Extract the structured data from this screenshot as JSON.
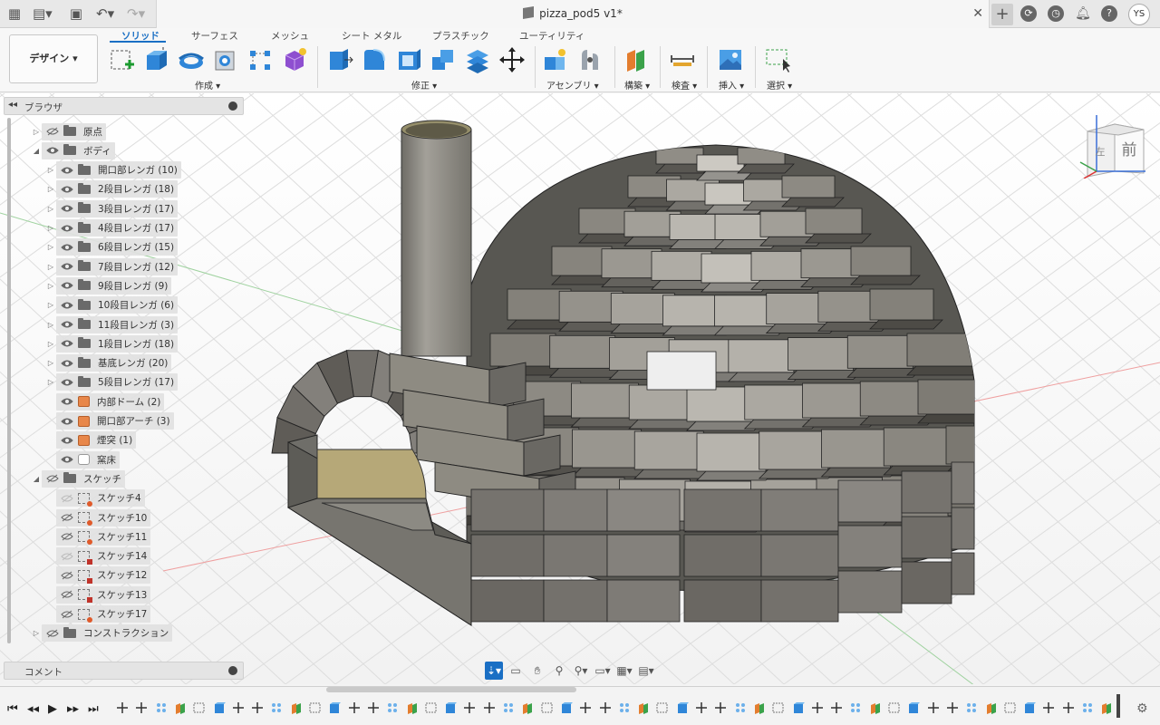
{
  "titlebar": {
    "doc_title": "pizza_pod5 v1*",
    "user_initials": "YS",
    "icons": [
      "grid-icon",
      "file-icon",
      "save-icon",
      "undo-icon",
      "redo-icon",
      "close-icon",
      "plus-icon",
      "cloud-icon",
      "clock-icon",
      "bell-icon",
      "help-icon"
    ]
  },
  "ribbon": {
    "design_label": "デザイン ▾",
    "tabs": [
      "ソリッド",
      "サーフェス",
      "メッシュ",
      "シート メタル",
      "プラスチック",
      "ユーティリティ"
    ],
    "groups": [
      "作成 ▾",
      "修正 ▾",
      "アセンブリ ▾",
      "構築 ▾",
      "検査 ▾",
      "挿入 ▾",
      "選択 ▾"
    ]
  },
  "browser": {
    "title": "ブラウザ",
    "nodes": [
      {
        "label": "原点",
        "type": "folder",
        "expand": "▷",
        "eye": "hidden",
        "level": 1
      },
      {
        "label": "ボディ",
        "type": "folder",
        "expand": "◢",
        "eye": "visible",
        "level": 1
      },
      {
        "label": "開口部レンガ (10)",
        "type": "folder",
        "expand": "▷",
        "eye": "visible",
        "level": 2
      },
      {
        "label": "2段目レンガ (18)",
        "type": "folder",
        "expand": "▷",
        "eye": "visible",
        "level": 2
      },
      {
        "label": "3段目レンガ (17)",
        "type": "folder",
        "expand": "▷",
        "eye": "visible",
        "level": 2
      },
      {
        "label": "4段目レンガ (17)",
        "type": "folder",
        "expand": "▷",
        "eye": "visible",
        "level": 2
      },
      {
        "label": "6段目レンガ (15)",
        "type": "folder",
        "expand": "▷",
        "eye": "visible",
        "level": 2
      },
      {
        "label": "7段目レンガ (12)",
        "type": "folder",
        "expand": "▷",
        "eye": "visible",
        "level": 2
      },
      {
        "label": "9段目レンガ (9)",
        "type": "folder",
        "expand": "▷",
        "eye": "visible",
        "level": 2
      },
      {
        "label": "10段目レンガ (6)",
        "type": "folder",
        "expand": "▷",
        "eye": "visible",
        "level": 2
      },
      {
        "label": "11段目レンガ (3)",
        "type": "folder",
        "expand": "▷",
        "eye": "visible",
        "level": 2
      },
      {
        "label": "1段目レンガ (18)",
        "type": "folder",
        "expand": "▷",
        "eye": "visible",
        "level": 2
      },
      {
        "label": "基底レンガ (20)",
        "type": "folder",
        "expand": "▷",
        "eye": "visible",
        "level": 2
      },
      {
        "label": "5段目レンガ (17)",
        "type": "folder",
        "expand": "▷",
        "eye": "visible",
        "level": 2
      },
      {
        "label": "内部ドーム (2)",
        "type": "body",
        "expand": "",
        "eye": "visible",
        "level": 2
      },
      {
        "label": "開口部アーチ (3)",
        "type": "body",
        "expand": "",
        "eye": "visible",
        "level": 2
      },
      {
        "label": "煙突 (1)",
        "type": "body",
        "expand": "",
        "eye": "visible",
        "level": 2
      },
      {
        "label": "窯床",
        "type": "floor",
        "expand": "",
        "eye": "visible",
        "level": 2
      },
      {
        "label": "スケッチ",
        "type": "folder",
        "expand": "◢",
        "eye": "hidden",
        "level": 1
      },
      {
        "label": "スケッチ4",
        "type": "sketch",
        "expand": "",
        "eye": "faint",
        "level": 2
      },
      {
        "label": "スケッチ10",
        "type": "sketch",
        "expand": "",
        "eye": "hidden",
        "level": 2
      },
      {
        "label": "スケッチ11",
        "type": "sketch",
        "expand": "",
        "eye": "hidden",
        "level": 2
      },
      {
        "label": "スケッチ14",
        "type": "sketch-lock",
        "expand": "",
        "eye": "faint",
        "level": 2
      },
      {
        "label": "スケッチ12",
        "type": "sketch-lock",
        "expand": "",
        "eye": "hidden",
        "level": 2
      },
      {
        "label": "スケッチ13",
        "type": "sketch-lock",
        "expand": "",
        "eye": "hidden",
        "level": 2
      },
      {
        "label": "スケッチ17",
        "type": "sketch",
        "expand": "",
        "eye": "hidden",
        "level": 2
      },
      {
        "label": "コンストラクション",
        "type": "folder",
        "expand": "▷",
        "eye": "hidden",
        "level": 1
      }
    ]
  },
  "comments": {
    "title": "コメント"
  },
  "viewcube": {
    "face_label": "前",
    "side_label": "左"
  },
  "navbar": {
    "icons": [
      "orbit-icon",
      "look-at-icon",
      "pan-icon",
      "zoom-icon",
      "zoom-window-icon",
      "display-settings-icon",
      "grid-settings-icon",
      "viewports-icon"
    ]
  },
  "timeline": {
    "item_count": 52
  },
  "colors": {
    "accent": "#1a6fc4",
    "brick": "#8a877e",
    "chimney": "#8c8a82",
    "grid": "#dcdcdc"
  }
}
